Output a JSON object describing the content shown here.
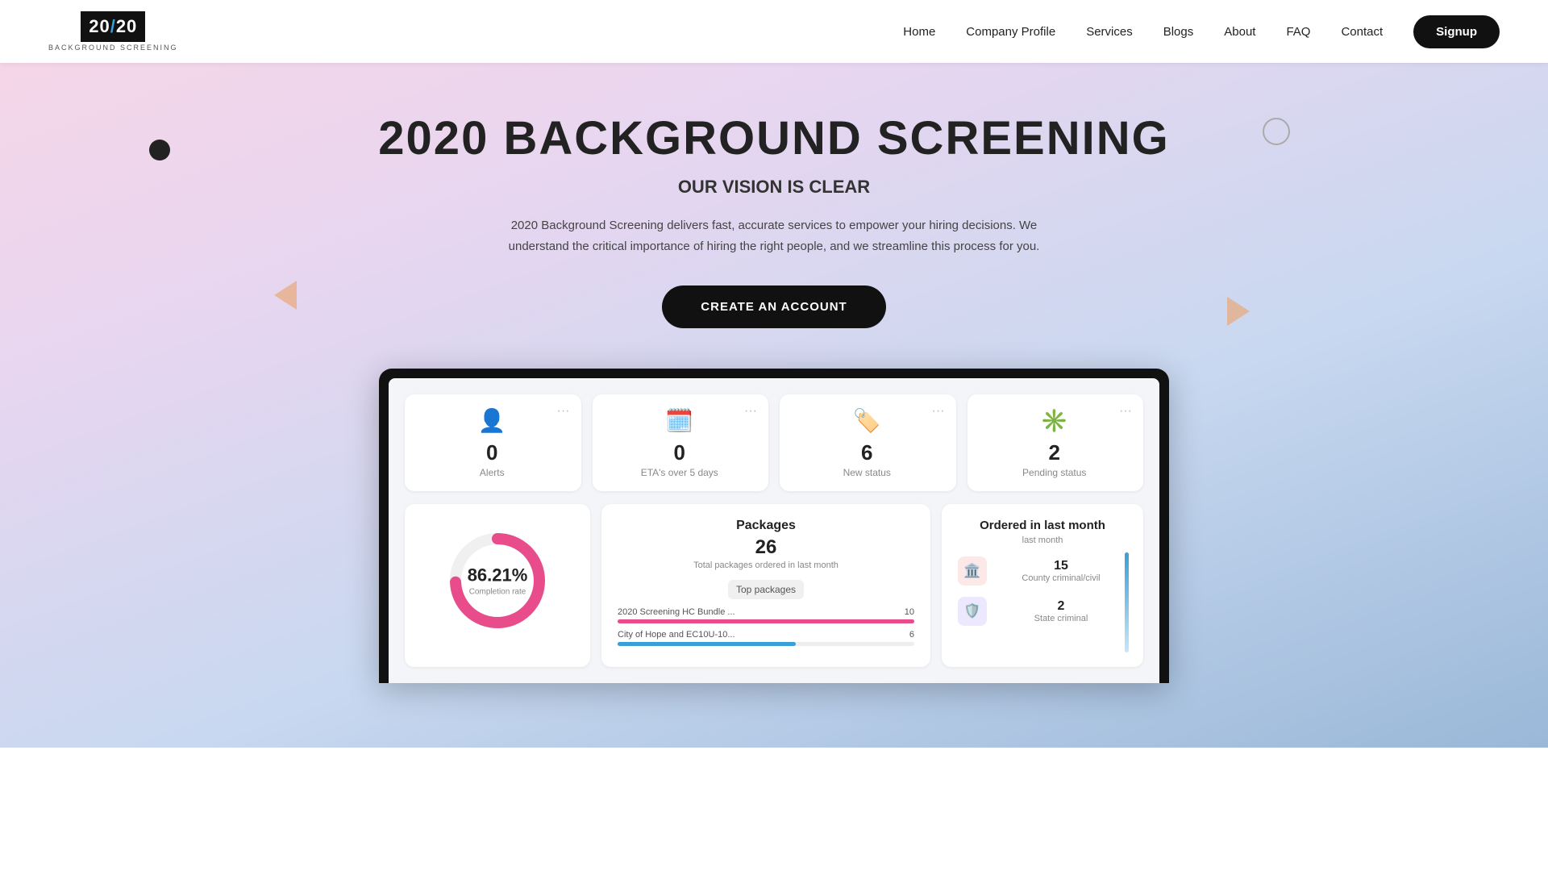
{
  "nav": {
    "logo_text": "20",
    "logo_slash": "/",
    "logo_text2": "20",
    "logo_sub": "BACKGROUND SCREENING",
    "links": [
      "Home",
      "Company Profile",
      "Services",
      "Blogs",
      "About",
      "FAQ",
      "Contact"
    ],
    "signup_label": "Signup"
  },
  "hero": {
    "title": "2020 BACKGROUND SCREENING",
    "subtitle": "OUR VISION IS CLEAR",
    "body": "2020 Background Screening delivers fast, accurate services to empower your hiring decisions. We understand the critical importance of hiring the right people, and we streamline this process for you.",
    "cta_label": "CREATE AN ACCOUNT"
  },
  "stats": [
    {
      "icon": "👤",
      "num": "0",
      "label": "Alerts"
    },
    {
      "icon": "🗓️",
      "num": "0",
      "label": "ETA's over 5 days"
    },
    {
      "icon": "🏷️",
      "num": "6",
      "label": "New status"
    },
    {
      "icon": "✳️",
      "num": "2",
      "label": "Pending status"
    }
  ],
  "donut": {
    "pct": "86.21%",
    "label": "Completion rate",
    "value": 86.21,
    "color_fill": "#e84c8b",
    "color_bg": "#f0f0f0"
  },
  "packages": {
    "title": "Packages",
    "count": "26",
    "sub": "Total packages ordered in last month",
    "top_label": "Top packages",
    "bars": [
      {
        "name": "2020 Screening HC Bundle ...",
        "value": 10,
        "max": 10,
        "color": "#e84c8b"
      },
      {
        "name": "City of Hope and EC10U-10...",
        "value": 6,
        "max": 10,
        "color": "#3a9fd6"
      }
    ]
  },
  "ordered": {
    "title": "Ordered in last month",
    "sub": "last month",
    "items": [
      {
        "icon": "🏛️",
        "type": "pink",
        "num": "15",
        "name": "County criminal/civil"
      },
      {
        "icon": "🛡️",
        "type": "purple",
        "num": "2",
        "name": "State criminal"
      }
    ]
  }
}
